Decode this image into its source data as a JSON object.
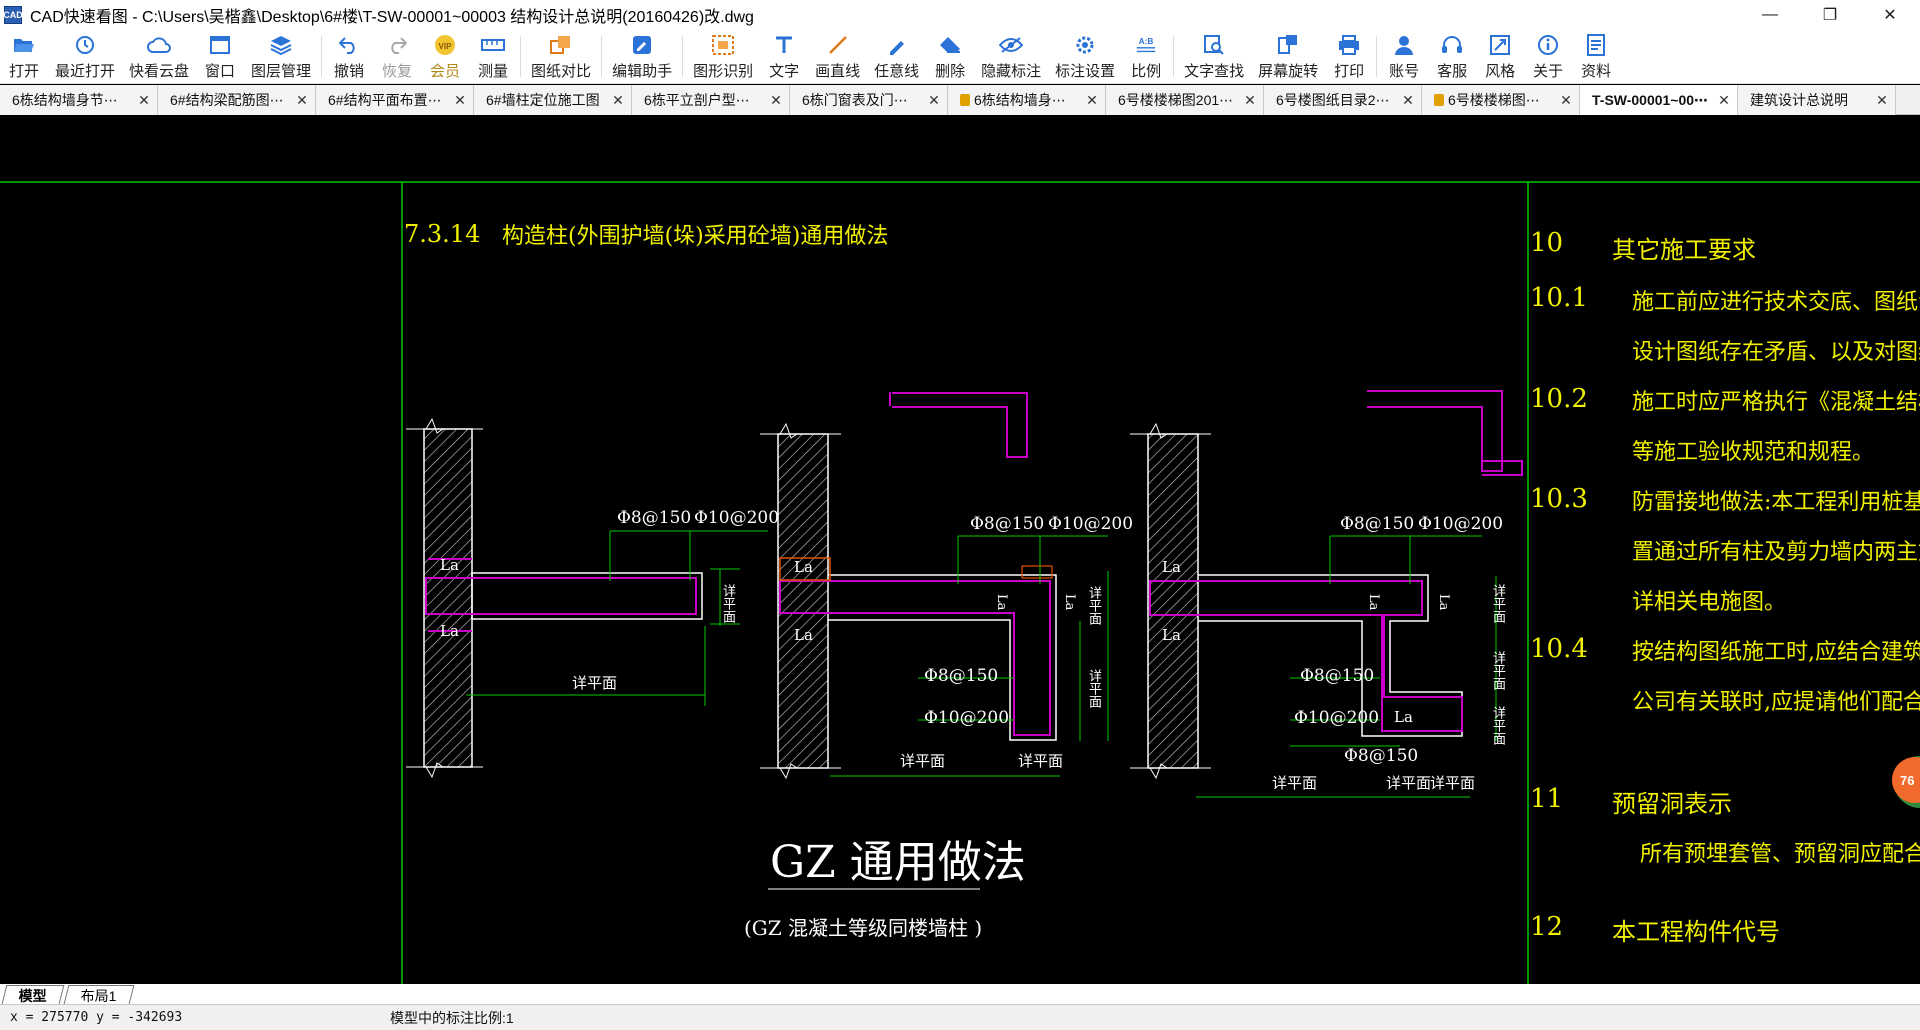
{
  "window": {
    "title": "CAD快速看图 - C:\\Users\\吴楷鑫\\Desktop\\6#楼\\T-SW-00001~00003 结构设计总说明(20160426)改.dwg",
    "logo_text": "CAD"
  },
  "toolbar": {
    "items": [
      {
        "label": "打开",
        "icon": "folder-open-icon"
      },
      {
        "label": "最近打开",
        "icon": "clock-icon"
      },
      {
        "label": "快看云盘",
        "icon": "cloud-icon"
      },
      {
        "label": "窗口",
        "icon": "window-icon"
      },
      {
        "label": "图层管理",
        "icon": "layers-icon"
      },
      {
        "label": "撤销",
        "icon": "undo-icon"
      },
      {
        "label": "恢复",
        "icon": "redo-icon"
      },
      {
        "label": "会员",
        "icon": "vip-icon"
      },
      {
        "label": "测量",
        "icon": "ruler-icon"
      },
      {
        "label": "图纸对比",
        "icon": "compare-icon"
      },
      {
        "label": "编辑助手",
        "icon": "edit-assistant-icon"
      },
      {
        "label": "图形识别",
        "icon": "shape-recognize-icon"
      },
      {
        "label": "文字",
        "icon": "text-icon"
      },
      {
        "label": "画直线",
        "icon": "line-icon"
      },
      {
        "label": "任意线",
        "icon": "freehand-icon"
      },
      {
        "label": "删除",
        "icon": "eraser-icon"
      },
      {
        "label": "隐藏标注",
        "icon": "eye-icon"
      },
      {
        "label": "标注设置",
        "icon": "annotation-settings-icon"
      },
      {
        "label": "比例",
        "icon": "scale-icon"
      },
      {
        "label": "文字查找",
        "icon": "text-search-icon"
      },
      {
        "label": "屏幕旋转",
        "icon": "rotate-screen-icon"
      },
      {
        "label": "打印",
        "icon": "printer-icon"
      },
      {
        "label": "账号",
        "icon": "user-icon"
      },
      {
        "label": "客服",
        "icon": "headset-icon"
      },
      {
        "label": "风格",
        "icon": "style-icon"
      },
      {
        "label": "关于",
        "icon": "info-icon"
      },
      {
        "label": "资料",
        "icon": "document-icon"
      }
    ],
    "scale_icon_text": "A:B"
  },
  "tabs": [
    {
      "label": "6栋结构墙身节⋯",
      "locked": false,
      "active": false
    },
    {
      "label": "6#结构梁配筋图⋯",
      "locked": false,
      "active": false
    },
    {
      "label": "6#结构平面布置⋯",
      "locked": false,
      "active": false
    },
    {
      "label": "6#墙柱定位施工图",
      "locked": false,
      "active": false
    },
    {
      "label": "6栋平立剖户型⋯",
      "locked": false,
      "active": false
    },
    {
      "label": "6栋门窗表及门⋯",
      "locked": false,
      "active": false
    },
    {
      "label": "6栋结构墙身⋯",
      "locked": true,
      "active": false
    },
    {
      "label": "6号楼楼梯图201⋯",
      "locked": false,
      "active": false
    },
    {
      "label": "6号楼图纸目录2⋯",
      "locked": false,
      "active": false
    },
    {
      "label": "6号楼楼梯图⋯",
      "locked": true,
      "active": false
    },
    {
      "label": "T-SW-00001~00⋯",
      "locked": false,
      "active": true
    },
    {
      "label": "建筑设计总说明",
      "locked": false,
      "active": false
    }
  ],
  "drawing": {
    "section_number": "7.3.14",
    "section_title": "构造柱(外围护墙(垛)采用砼墙)通用做法",
    "main_title": "GZ 通用做法",
    "subtitle": "(GZ 混凝土等级同楼墙柱 )",
    "labels": {
      "rebar_8_150": "Φ8@150",
      "rebar_10_200": "Φ10@200",
      "la": "La",
      "see_plan": "详平面"
    },
    "notes": [
      {
        "num": "10",
        "text": "其它施工要求"
      },
      {
        "num": "10.1",
        "text": "施工前应进行技术交底、图纸会审。施工过"
      },
      {
        "num": "",
        "text": "设计图纸存在矛盾、以及对图纸产生任何疑"
      },
      {
        "num": "10.2",
        "text": "施工时应严格执行《混凝土结构工程施工质"
      },
      {
        "num": "",
        "text": "等施工验收规范和规程。"
      },
      {
        "num": "10.3",
        "text": "防雷接地做法:本工程利用桩基、承台及基础"
      },
      {
        "num": "",
        "text": "置通过所有柱及剪力墙内两主筋上下通长焊"
      },
      {
        "num": "",
        "text": "详相关电施图。"
      },
      {
        "num": "10.4",
        "text": "按结构图纸施工时,应结合建筑、设备等各专"
      },
      {
        "num": "",
        "text": "公司有关联时,应提请他们配合施工。"
      },
      {
        "num": "11",
        "text": "预留洞表示"
      },
      {
        "num": "",
        "text": "所有预埋套管、预留洞应配合各专业图纸施"
      },
      {
        "num": "12",
        "text": "本工程构件代号"
      }
    ]
  },
  "float_badge": "76",
  "layout_tabs": [
    {
      "label": "模型",
      "active": true
    },
    {
      "label": "布局1",
      "active": false
    }
  ],
  "status": {
    "coords": "x = 275770  y = -342693",
    "scale_text": "模型中的标注比例:1"
  },
  "colors": {
    "cad_yellow": "#f0f000",
    "cad_green": "#00c800",
    "cad_magenta": "#c800c8",
    "cad_white": "#ffffff",
    "toolbar_blue": "#2b73d6"
  }
}
